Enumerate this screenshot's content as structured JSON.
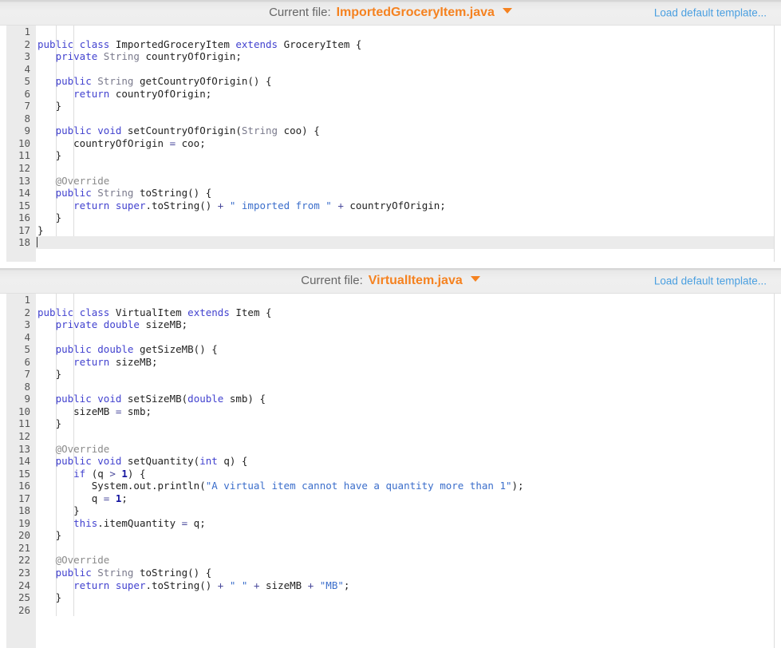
{
  "panels": [
    {
      "header": {
        "current_file_label": "Current file:",
        "file_name": "ImportedGroceryItem.java",
        "dropdown_icon": "chevron-down-icon",
        "load_template_label": "Load default template..."
      },
      "editor": {
        "active_line": 18,
        "total_lines": 18,
        "lines": [
          {
            "n": 1,
            "tokens": []
          },
          {
            "n": 2,
            "tokens": [
              {
                "t": "public",
                "c": "k"
              },
              {
                "t": " ",
                "c": "pl"
              },
              {
                "t": "class",
                "c": "k"
              },
              {
                "t": " ImportedGroceryItem ",
                "c": "pl"
              },
              {
                "t": "extends",
                "c": "k"
              },
              {
                "t": " GroceryItem {",
                "c": "pl"
              }
            ]
          },
          {
            "n": 3,
            "tokens": [
              {
                "t": "   ",
                "c": "pl"
              },
              {
                "t": "private",
                "c": "k"
              },
              {
                "t": " ",
                "c": "pl"
              },
              {
                "t": "String",
                "c": "ty"
              },
              {
                "t": " countryOfOrigin;",
                "c": "pl"
              }
            ]
          },
          {
            "n": 4,
            "tokens": []
          },
          {
            "n": 5,
            "tokens": [
              {
                "t": "   ",
                "c": "pl"
              },
              {
                "t": "public",
                "c": "k"
              },
              {
                "t": " ",
                "c": "pl"
              },
              {
                "t": "String",
                "c": "ty"
              },
              {
                "t": " getCountryOfOrigin() {",
                "c": "pl"
              }
            ]
          },
          {
            "n": 6,
            "tokens": [
              {
                "t": "      ",
                "c": "pl"
              },
              {
                "t": "return",
                "c": "k"
              },
              {
                "t": " countryOfOrigin;",
                "c": "pl"
              }
            ]
          },
          {
            "n": 7,
            "tokens": [
              {
                "t": "   }",
                "c": "pl"
              }
            ]
          },
          {
            "n": 8,
            "tokens": []
          },
          {
            "n": 9,
            "tokens": [
              {
                "t": "   ",
                "c": "pl"
              },
              {
                "t": "public",
                "c": "k"
              },
              {
                "t": " ",
                "c": "pl"
              },
              {
                "t": "void",
                "c": "k"
              },
              {
                "t": " setCountryOfOrigin(",
                "c": "pl"
              },
              {
                "t": "String",
                "c": "ty"
              },
              {
                "t": " coo) {",
                "c": "pl"
              }
            ]
          },
          {
            "n": 10,
            "tokens": [
              {
                "t": "      countryOfOrigin ",
                "c": "pl"
              },
              {
                "t": "=",
                "c": "op"
              },
              {
                "t": " coo;",
                "c": "pl"
              }
            ]
          },
          {
            "n": 11,
            "tokens": [
              {
                "t": "   }",
                "c": "pl"
              }
            ]
          },
          {
            "n": 12,
            "tokens": []
          },
          {
            "n": 13,
            "tokens": [
              {
                "t": "   ",
                "c": "pl"
              },
              {
                "t": "@Override",
                "c": "an"
              }
            ]
          },
          {
            "n": 14,
            "tokens": [
              {
                "t": "   ",
                "c": "pl"
              },
              {
                "t": "public",
                "c": "k"
              },
              {
                "t": " ",
                "c": "pl"
              },
              {
                "t": "String",
                "c": "ty"
              },
              {
                "t": " toString() {",
                "c": "pl"
              }
            ]
          },
          {
            "n": 15,
            "tokens": [
              {
                "t": "      ",
                "c": "pl"
              },
              {
                "t": "return",
                "c": "k"
              },
              {
                "t": " ",
                "c": "pl"
              },
              {
                "t": "super",
                "c": "k"
              },
              {
                "t": ".toString() ",
                "c": "pl"
              },
              {
                "t": "+",
                "c": "op"
              },
              {
                "t": " ",
                "c": "pl"
              },
              {
                "t": "\" imported from \"",
                "c": "st"
              },
              {
                "t": " ",
                "c": "pl"
              },
              {
                "t": "+",
                "c": "op"
              },
              {
                "t": " countryOfOrigin;",
                "c": "pl"
              }
            ]
          },
          {
            "n": 16,
            "tokens": [
              {
                "t": "   }",
                "c": "pl"
              }
            ]
          },
          {
            "n": 17,
            "tokens": [
              {
                "t": "}",
                "c": "pl"
              }
            ]
          },
          {
            "n": 18,
            "tokens": []
          }
        ]
      }
    },
    {
      "header": {
        "current_file_label": "Current file:",
        "file_name": "VirtualItem.java",
        "dropdown_icon": "chevron-down-icon",
        "load_template_label": "Load default template..."
      },
      "editor": {
        "active_line": 0,
        "total_lines": 26,
        "lines": [
          {
            "n": 1,
            "tokens": []
          },
          {
            "n": 2,
            "tokens": [
              {
                "t": "public",
                "c": "k"
              },
              {
                "t": " ",
                "c": "pl"
              },
              {
                "t": "class",
                "c": "k"
              },
              {
                "t": " VirtualItem ",
                "c": "pl"
              },
              {
                "t": "extends",
                "c": "k"
              },
              {
                "t": " Item {",
                "c": "pl"
              }
            ]
          },
          {
            "n": 3,
            "tokens": [
              {
                "t": "   ",
                "c": "pl"
              },
              {
                "t": "private",
                "c": "k"
              },
              {
                "t": " ",
                "c": "pl"
              },
              {
                "t": "double",
                "c": "k"
              },
              {
                "t": " sizeMB;",
                "c": "pl"
              }
            ]
          },
          {
            "n": 4,
            "tokens": []
          },
          {
            "n": 5,
            "tokens": [
              {
                "t": "   ",
                "c": "pl"
              },
              {
                "t": "public",
                "c": "k"
              },
              {
                "t": " ",
                "c": "pl"
              },
              {
                "t": "double",
                "c": "k"
              },
              {
                "t": " getSizeMB() {",
                "c": "pl"
              }
            ]
          },
          {
            "n": 6,
            "tokens": [
              {
                "t": "      ",
                "c": "pl"
              },
              {
                "t": "return",
                "c": "k"
              },
              {
                "t": " sizeMB;",
                "c": "pl"
              }
            ]
          },
          {
            "n": 7,
            "tokens": [
              {
                "t": "   }",
                "c": "pl"
              }
            ]
          },
          {
            "n": 8,
            "tokens": []
          },
          {
            "n": 9,
            "tokens": [
              {
                "t": "   ",
                "c": "pl"
              },
              {
                "t": "public",
                "c": "k"
              },
              {
                "t": " ",
                "c": "pl"
              },
              {
                "t": "void",
                "c": "k"
              },
              {
                "t": " setSizeMB(",
                "c": "pl"
              },
              {
                "t": "double",
                "c": "k"
              },
              {
                "t": " smb) {",
                "c": "pl"
              }
            ]
          },
          {
            "n": 10,
            "tokens": [
              {
                "t": "      sizeMB ",
                "c": "pl"
              },
              {
                "t": "=",
                "c": "op"
              },
              {
                "t": " smb;",
                "c": "pl"
              }
            ]
          },
          {
            "n": 11,
            "tokens": [
              {
                "t": "   }",
                "c": "pl"
              }
            ]
          },
          {
            "n": 12,
            "tokens": []
          },
          {
            "n": 13,
            "tokens": [
              {
                "t": "   ",
                "c": "pl"
              },
              {
                "t": "@Override",
                "c": "an"
              }
            ]
          },
          {
            "n": 14,
            "tokens": [
              {
                "t": "   ",
                "c": "pl"
              },
              {
                "t": "public",
                "c": "k"
              },
              {
                "t": " ",
                "c": "pl"
              },
              {
                "t": "void",
                "c": "k"
              },
              {
                "t": " setQuantity(",
                "c": "pl"
              },
              {
                "t": "int",
                "c": "k"
              },
              {
                "t": " q) {",
                "c": "pl"
              }
            ]
          },
          {
            "n": 15,
            "tokens": [
              {
                "t": "      ",
                "c": "pl"
              },
              {
                "t": "if",
                "c": "k"
              },
              {
                "t": " (q ",
                "c": "pl"
              },
              {
                "t": ">",
                "c": "op"
              },
              {
                "t": " ",
                "c": "pl"
              },
              {
                "t": "1",
                "c": "nu"
              },
              {
                "t": ") {",
                "c": "pl"
              }
            ]
          },
          {
            "n": 16,
            "tokens": [
              {
                "t": "         System.out.println(",
                "c": "pl"
              },
              {
                "t": "\"A virtual item cannot have a quantity more than 1\"",
                "c": "st"
              },
              {
                "t": ");",
                "c": "pl"
              }
            ]
          },
          {
            "n": 17,
            "tokens": [
              {
                "t": "         q ",
                "c": "pl"
              },
              {
                "t": "=",
                "c": "op"
              },
              {
                "t": " ",
                "c": "pl"
              },
              {
                "t": "1",
                "c": "nu"
              },
              {
                "t": ";",
                "c": "pl"
              }
            ]
          },
          {
            "n": 18,
            "tokens": [
              {
                "t": "      }",
                "c": "pl"
              }
            ]
          },
          {
            "n": 19,
            "tokens": [
              {
                "t": "      ",
                "c": "pl"
              },
              {
                "t": "this",
                "c": "k"
              },
              {
                "t": ".itemQuantity ",
                "c": "pl"
              },
              {
                "t": "=",
                "c": "op"
              },
              {
                "t": " q;",
                "c": "pl"
              }
            ]
          },
          {
            "n": 20,
            "tokens": [
              {
                "t": "   }",
                "c": "pl"
              }
            ]
          },
          {
            "n": 21,
            "tokens": []
          },
          {
            "n": 22,
            "tokens": [
              {
                "t": "   ",
                "c": "pl"
              },
              {
                "t": "@Override",
                "c": "an"
              }
            ]
          },
          {
            "n": 23,
            "tokens": [
              {
                "t": "   ",
                "c": "pl"
              },
              {
                "t": "public",
                "c": "k"
              },
              {
                "t": " ",
                "c": "pl"
              },
              {
                "t": "String",
                "c": "ty"
              },
              {
                "t": " toString() {",
                "c": "pl"
              }
            ]
          },
          {
            "n": 24,
            "tokens": [
              {
                "t": "      ",
                "c": "pl"
              },
              {
                "t": "return",
                "c": "k"
              },
              {
                "t": " ",
                "c": "pl"
              },
              {
                "t": "super",
                "c": "k"
              },
              {
                "t": ".toString() ",
                "c": "pl"
              },
              {
                "t": "+",
                "c": "op"
              },
              {
                "t": " ",
                "c": "pl"
              },
              {
                "t": "\" \"",
                "c": "st"
              },
              {
                "t": " ",
                "c": "pl"
              },
              {
                "t": "+",
                "c": "op"
              },
              {
                "t": " sizeMB ",
                "c": "pl"
              },
              {
                "t": "+",
                "c": "op"
              },
              {
                "t": " ",
                "c": "pl"
              },
              {
                "t": "\"MB\"",
                "c": "st"
              },
              {
                "t": ";",
                "c": "pl"
              }
            ]
          },
          {
            "n": 25,
            "tokens": [
              {
                "t": "   }",
                "c": "pl"
              }
            ]
          },
          {
            "n": 26,
            "tokens": []
          }
        ]
      }
    }
  ],
  "colors": {
    "accent_orange": "#f58220",
    "link_blue": "#4a9fe0",
    "keyword_blue": "#4242cf",
    "string_blue": "#3b6ecb",
    "type_gray": "#7a7a8c",
    "number_navy": "#12129e",
    "annotation_gray": "#8a8a8a",
    "gutter_bg": "#ebebeb",
    "header_bg": "#eeeeee"
  },
  "layout": {
    "panel_one_code_height": 296,
    "panel_two_code_height": 444
  }
}
